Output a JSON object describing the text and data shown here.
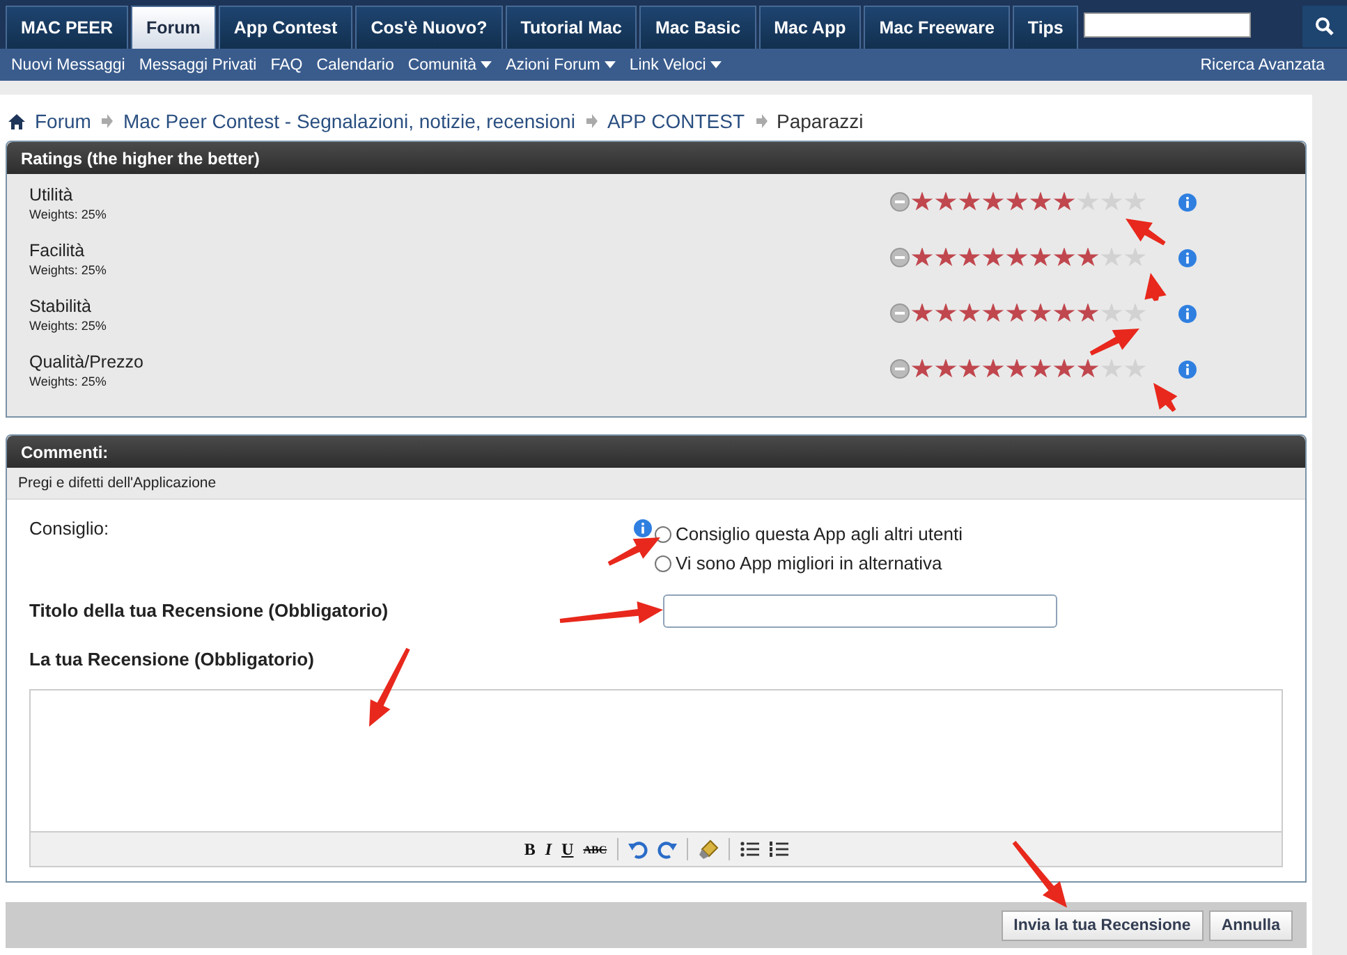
{
  "nav": {
    "tabs": [
      {
        "label": "MAC PEER",
        "selected": false
      },
      {
        "label": "Forum",
        "selected": true
      },
      {
        "label": "App Contest",
        "selected": false
      },
      {
        "label": "Cos'è Nuovo?",
        "selected": false
      },
      {
        "label": "Tutorial Mac",
        "selected": false
      },
      {
        "label": "Mac Basic",
        "selected": false
      },
      {
        "label": "Mac App",
        "selected": false
      },
      {
        "label": "Mac Freeware",
        "selected": false
      },
      {
        "label": "Tips",
        "selected": false
      }
    ]
  },
  "subnav": {
    "links": [
      {
        "label": "Nuovi Messaggi",
        "dropdown": false
      },
      {
        "label": "Messaggi Privati",
        "dropdown": false
      },
      {
        "label": "FAQ",
        "dropdown": false
      },
      {
        "label": "Calendario",
        "dropdown": false
      },
      {
        "label": "Comunità",
        "dropdown": true
      },
      {
        "label": "Azioni Forum",
        "dropdown": true
      },
      {
        "label": "Link Veloci",
        "dropdown": true
      }
    ],
    "advanced_search": "Ricerca Avanzata"
  },
  "breadcrumb": [
    "Forum",
    "Mac Peer Contest - Segnalazioni, notizie, recensioni",
    "APP CONTEST",
    "Paparazzi"
  ],
  "ratings": {
    "title": "Ratings (the higher the better)",
    "rows": [
      {
        "name": "Utilità",
        "weight": "Weights: 25%",
        "stars": 7
      },
      {
        "name": "Facilità",
        "weight": "Weights: 25%",
        "stars": 8
      },
      {
        "name": "Stabilità",
        "weight": "Weights: 25%",
        "stars": 8
      },
      {
        "name": "Qualità/Prezzo",
        "weight": "Weights: 25%",
        "stars": 8
      }
    ]
  },
  "comments": {
    "title": "Commenti:",
    "subtitle": "Pregi e difetti dell'Applicazione",
    "advice_label": "Consiglio:",
    "options": [
      {
        "label": "Consiglio questa App agli altri utenti",
        "selected": false
      },
      {
        "label": "Vi sono App migliori in alternativa",
        "selected": false
      }
    ],
    "title_label": "Titolo della tua Recensione (Obbligatorio)",
    "review_label": "La tua Recensione (Obbligatorio)",
    "toolbar": [
      "B",
      "I",
      "U",
      "ABC"
    ]
  },
  "buttons": [
    {
      "label": "Invia la tua Recensione"
    },
    {
      "label": "Annulla"
    }
  ]
}
